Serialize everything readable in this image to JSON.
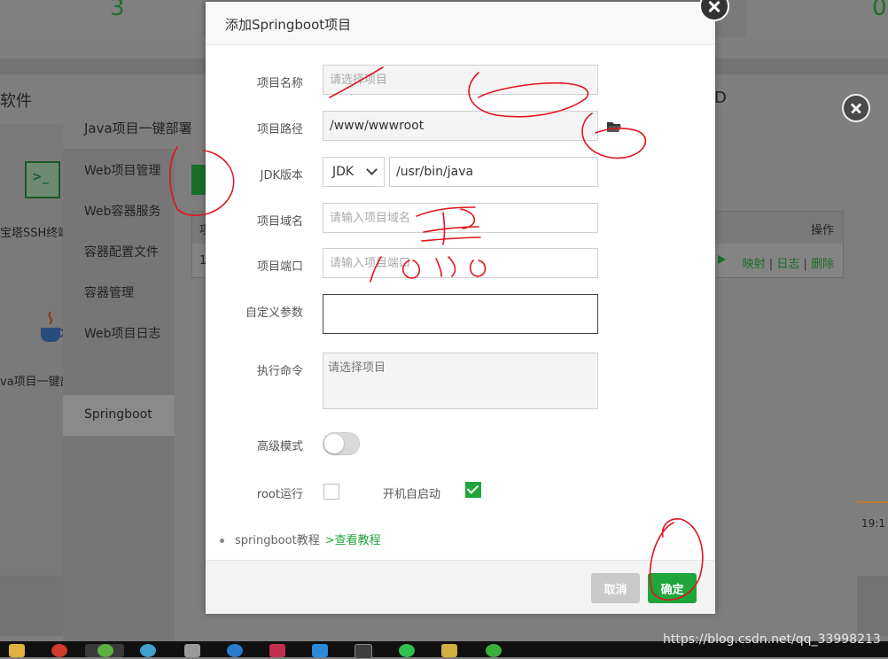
{
  "background": {
    "top_numbers": [
      "3",
      "0"
    ],
    "section_title": "软件",
    "section_right_letter": "D",
    "tiles": [
      {
        "label": "宝塔SSH终端",
        "icon": "terminal-icon"
      },
      {
        "label": "va项目一键部",
        "icon": "java-cup-icon"
      }
    ],
    "time_label": "19:1"
  },
  "java_window": {
    "title": "Java项目一键部署",
    "sidebar": [
      {
        "label": "Web项目管理"
      },
      {
        "label": "Web容器服务"
      },
      {
        "label": "容器配置文件"
      },
      {
        "label": "容器管理"
      },
      {
        "label": "Web项目日志"
      },
      {
        "label": "Springboot",
        "active": true
      }
    ],
    "table": {
      "head_first_cell": "项",
      "first_row_cell": "1",
      "ops_header": "操作",
      "ops": [
        "映射",
        "日志",
        "删除"
      ]
    }
  },
  "dialog": {
    "title": "添加Springboot项目",
    "fields": {
      "project_name": {
        "label": "项目名称",
        "value": "",
        "placeholder": "请选择项目"
      },
      "project_path": {
        "label": "项目路径",
        "value": "/www/wwwroot"
      },
      "jdk_version": {
        "label": "JDK版本",
        "selected": "JDK",
        "path": "/usr/bin/java"
      },
      "project_domain": {
        "label": "项目域名",
        "value": "",
        "placeholder": "请输入项目域名"
      },
      "project_port": {
        "label": "项目端口",
        "value": "",
        "placeholder": "请输入项目端口"
      },
      "custom_params": {
        "label": "自定义参数",
        "value": ""
      },
      "exec_command": {
        "label": "执行命令",
        "value": "",
        "placeholder": "请选择项目"
      },
      "advanced_mode": {
        "label": "高级模式",
        "enabled": false
      },
      "root_run": {
        "label": "root运行",
        "checked": false
      },
      "autostart": {
        "label": "开机自启动",
        "checked": true
      }
    },
    "tutorial": {
      "text": "springboot教程",
      "link": ">查看教程"
    },
    "buttons": {
      "cancel": "取消",
      "ok": "确定"
    }
  },
  "watermark": "https://blog.csdn.net/qq_33998213",
  "colors": {
    "accent": "#20a53a",
    "annotation": "#e0141e"
  }
}
